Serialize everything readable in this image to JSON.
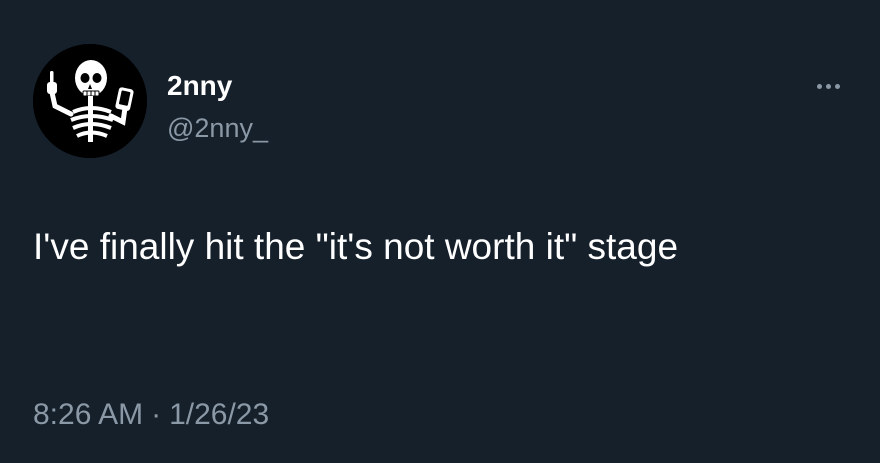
{
  "author": {
    "display_name": "2nny",
    "handle": "@2nny_"
  },
  "tweet": {
    "text": "I've finally hit the \"it's not worth it\" stage",
    "time": "8:26 AM",
    "separator": "·",
    "date": "1/26/23"
  },
  "icons": {
    "avatar": "skeleton-with-phone-avatar",
    "more": "more-horizontal-icon"
  },
  "colors": {
    "background": "#15202b",
    "primary_text": "#ffffff",
    "secondary_text": "#8b98a5"
  }
}
